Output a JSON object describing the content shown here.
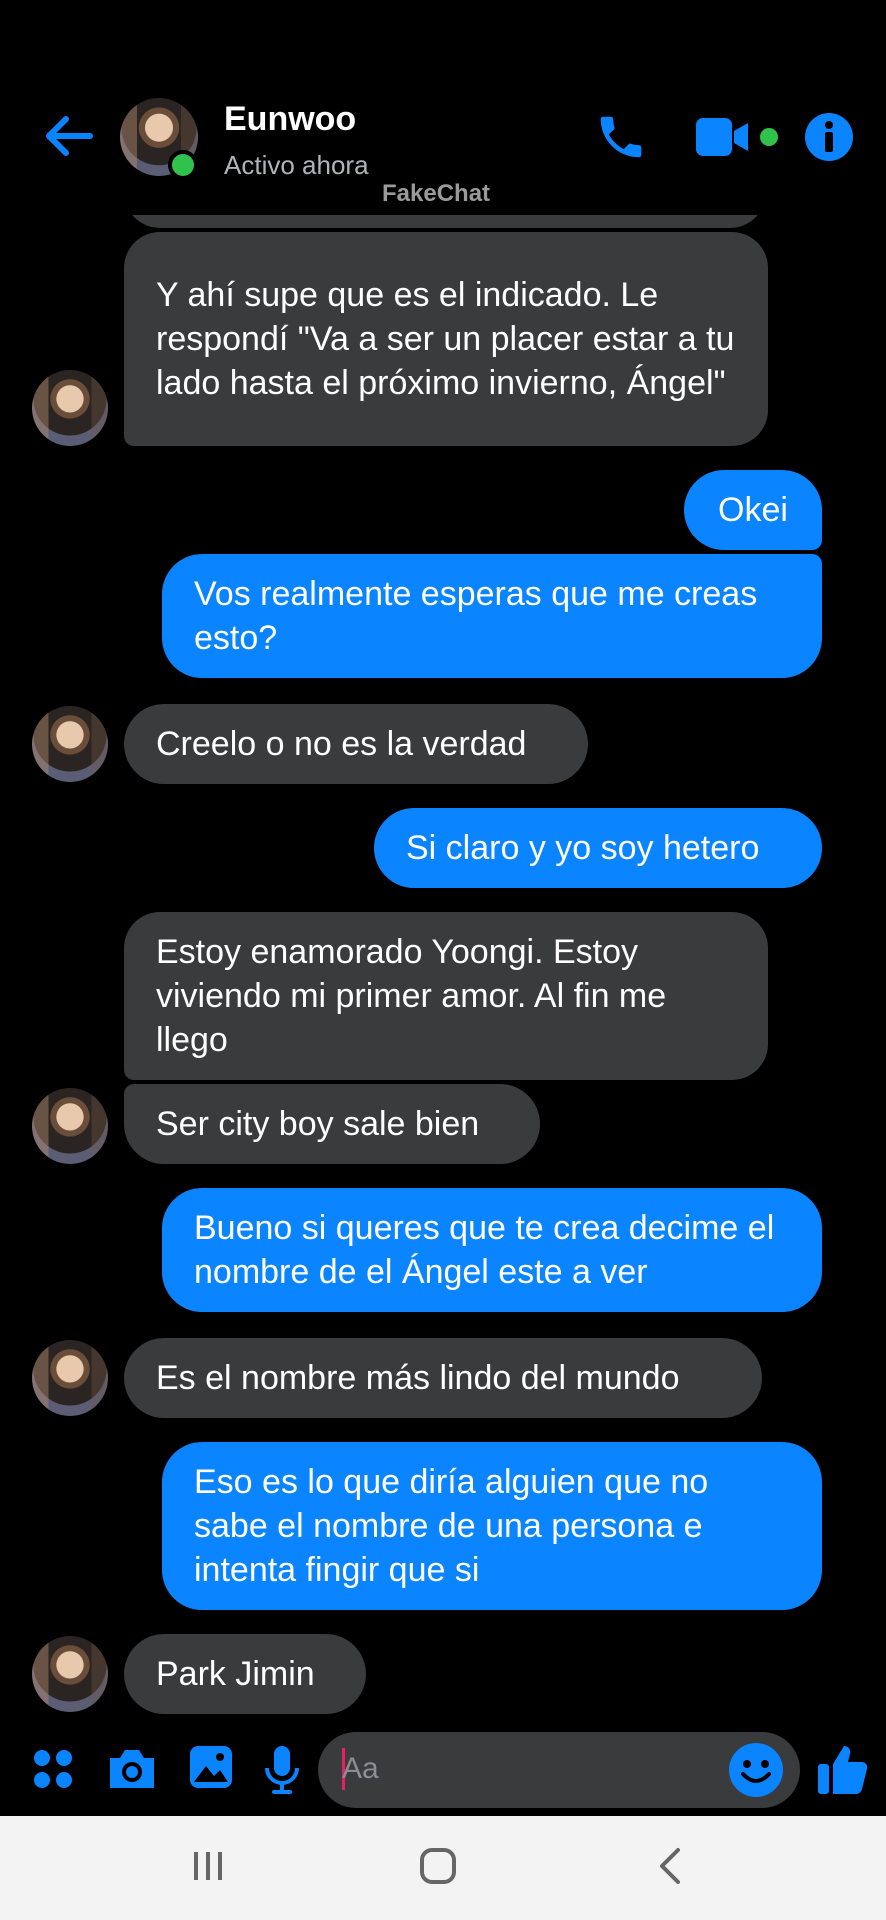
{
  "header": {
    "contact_name": "Eunwoo",
    "status": "Activo ahora",
    "watermark": "FakeChat",
    "icons": [
      "back-arrow-icon",
      "phone-icon",
      "video-camera-icon",
      "info-icon"
    ],
    "accent_color": "#0a84ff",
    "online_color": "#31c24d"
  },
  "messages": [
    {
      "from": "them",
      "text": "Y ahí supe que es el indicado. Le respondí \"Va a ser un placer estar a tu lado hasta el próximo invierno, Ángel\""
    },
    {
      "from": "me",
      "text": "Okei"
    },
    {
      "from": "me",
      "text": "Vos realmente esperas que me creas esto?"
    },
    {
      "from": "them",
      "text": "Creelo o no es la verdad"
    },
    {
      "from": "me",
      "text": "Si claro y yo soy hetero"
    },
    {
      "from": "them",
      "text": "Estoy enamorado Yoongi. Estoy viviendo mi primer amor. Al fin me llego"
    },
    {
      "from": "them",
      "text": "Ser city boy sale bien"
    },
    {
      "from": "me",
      "text": "Bueno si queres que te crea decime el nombre de el Ángel este a ver"
    },
    {
      "from": "them",
      "text": "Es el nombre más lindo del mundo"
    },
    {
      "from": "me",
      "text": "Eso es lo que diría alguien que no sabe el nombre de una persona e intenta fingir que si"
    },
    {
      "from": "them",
      "text": "Park Jimin"
    }
  ],
  "composer": {
    "placeholder": "Aa",
    "icons": [
      "apps-grid-icon",
      "camera-icon",
      "gallery-icon",
      "microphone-icon",
      "emoji-icon",
      "thumbs-up-icon"
    ]
  },
  "navbar": {
    "icons": [
      "recent-apps-icon",
      "home-icon",
      "back-icon"
    ]
  },
  "colors": {
    "incoming_bubble": "#3a3b3c",
    "outgoing_bubble": "#0a84ff",
    "background": "#000000"
  }
}
